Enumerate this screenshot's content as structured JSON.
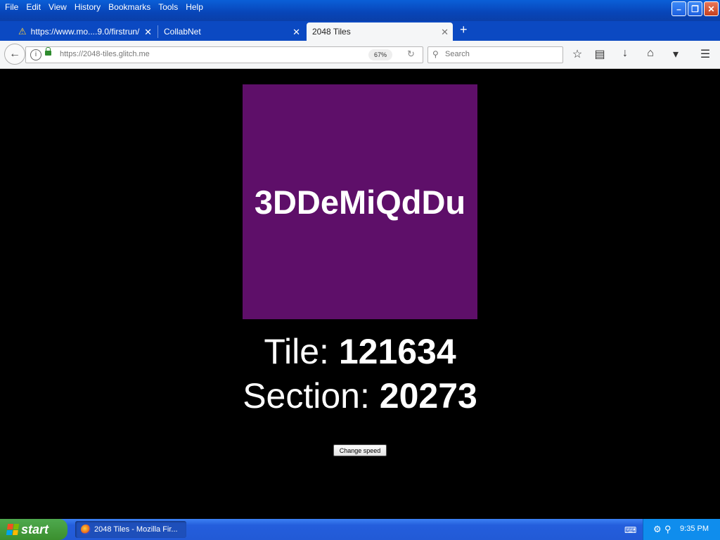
{
  "browser": {
    "menu": [
      "File",
      "Edit",
      "View",
      "History",
      "Bookmarks",
      "Tools",
      "Help"
    ],
    "tabs": [
      {
        "label": "https://www.mo....9.0/firstrun/",
        "active": false,
        "warning": true
      },
      {
        "label": "CollabNet",
        "active": false
      },
      {
        "label": "2048 Tiles",
        "active": true
      }
    ],
    "url": "https://2048-tiles.glitch.me",
    "zoom": "67%",
    "search_placeholder": "Search"
  },
  "page": {
    "tile_text": "3DDeMiQdDu",
    "tile_color": "#5e0f69",
    "tile_label": "Tile:",
    "tile_value": "121634",
    "section_label": "Section:",
    "section_value": "20273",
    "speed_button": "Change speed"
  },
  "taskbar": {
    "start": "start",
    "window": "2048 Tiles - Mozilla Fir...",
    "clock": "9:35 PM"
  }
}
